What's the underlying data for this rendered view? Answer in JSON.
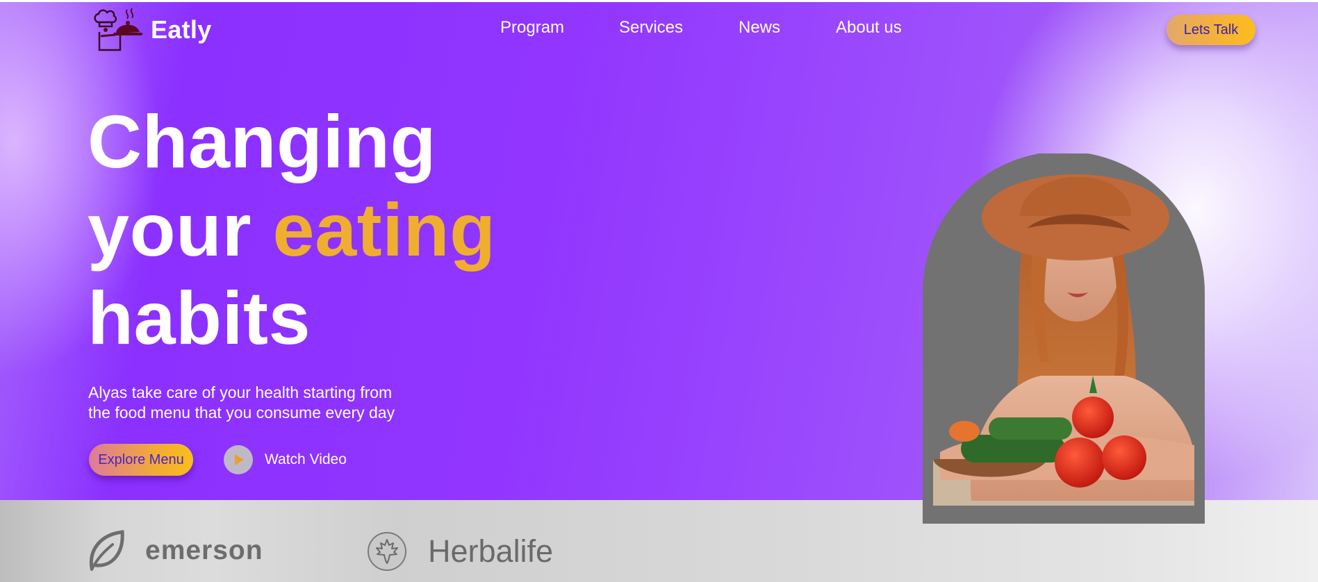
{
  "header": {
    "brand_name": "Eatly",
    "brand_icon": "chef-icon",
    "nav": [
      {
        "label": "Program"
      },
      {
        "label": "Services"
      },
      {
        "label": "News"
      },
      {
        "label": "About us"
      }
    ],
    "cta_label": "Lets Talk"
  },
  "hero": {
    "headline_line1": "Changing",
    "headline_line2_prefix": "your ",
    "headline_line2_accent": "eating",
    "headline_line3": "habits",
    "subtitle_line1": "Alyas take care of your health starting from",
    "subtitle_line2": "the food menu that you consume every day",
    "explore_label": "Explore Menu",
    "watch_label": "Watch Video",
    "accent_color": "#f0ae30",
    "image": "woman-with-vegetables-photo"
  },
  "partners": [
    {
      "name": "emerson",
      "icon": "leaf-icon"
    },
    {
      "name": "Herbalife",
      "icon": "maple-leaf-icon"
    }
  ],
  "colors": {
    "hero_purple": "#8b30ff",
    "button_gold": "#f5b13a"
  }
}
